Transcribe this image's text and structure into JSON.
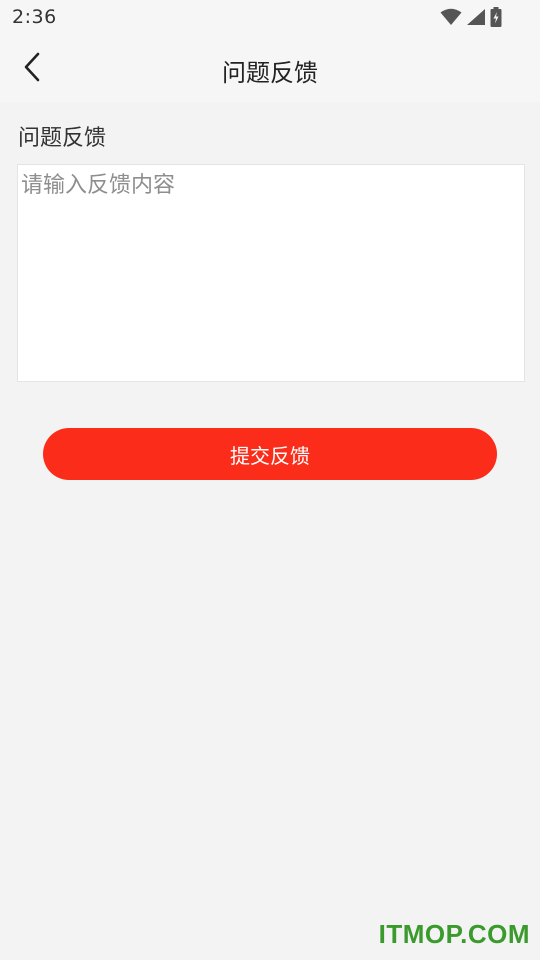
{
  "status_bar": {
    "time": "2:36",
    "icons": [
      "wifi-icon",
      "signal-icon",
      "battery-charging-icon"
    ]
  },
  "app_bar": {
    "back_icon": "chevron-left-icon",
    "title": "问题反馈"
  },
  "form": {
    "label": "问题反馈",
    "placeholder": "请输入反馈内容",
    "value": "",
    "submit_label": "提交反馈"
  },
  "watermark": "ITMOP.COM",
  "colors": {
    "accent": "#fb2d1a",
    "background": "#f3f3f3",
    "watermark": "#3a9a2c"
  }
}
